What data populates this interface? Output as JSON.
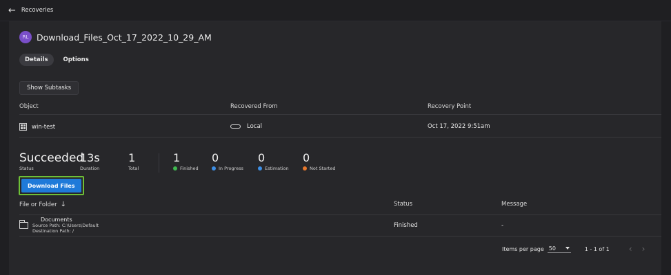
{
  "topbar": {
    "back_glyph": "←",
    "breadcrumb": "Recoveries"
  },
  "header": {
    "avatar_text": "RL",
    "title": "Download_Files_Oct_17_2022_10_29_AM"
  },
  "tabs": [
    {
      "label": "Details",
      "active": true
    },
    {
      "label": "Options",
      "active": false
    }
  ],
  "show_subtasks_label": "Show Subtasks",
  "objects_table": {
    "headers": {
      "object": "Object",
      "recovered_from": "Recovered From",
      "recovery_point": "Recovery Point"
    },
    "row": {
      "object": "win-test",
      "recovered_from": "Local",
      "recovery_point": "Oct 17, 2022 9:51am",
      "object_icon": "windows-icon",
      "source_icon": "cloud-icon"
    }
  },
  "stats": {
    "status_value": "Succeeded",
    "status_label": "Status",
    "duration_value": "13s",
    "duration_label": "Duration",
    "total_value": "1",
    "total_label": "Total",
    "finished_value": "1",
    "finished_label": "Finished",
    "in_progress_value": "0",
    "in_progress_label": "In Progress",
    "estimation_value": "0",
    "estimation_label": "Estimation",
    "not_started_value": "0",
    "not_started_label": "Not Started"
  },
  "colors": {
    "finished": "#3fb950",
    "in_progress": "#3d8fe6",
    "estimation": "#3d8fe6",
    "not_started": "#e6782d",
    "accent_button": "#1f7ad9",
    "highlight": "#6ec037"
  },
  "download_button_label": "Download Files",
  "files_table": {
    "headers": {
      "file_or_folder": "File or Folder",
      "sort_glyph": "↓",
      "status": "Status",
      "message": "Message"
    },
    "rows": [
      {
        "name": "Documents",
        "source_path": "Source Path: C:\\Users\\Default",
        "destination_path": "Destination Path: /",
        "status": "Finished",
        "message": "-"
      }
    ]
  },
  "pagination": {
    "items_per_page_label": "Items per page",
    "items_per_page_value": "50",
    "range": "1 - 1 of 1",
    "prev_glyph": "‹",
    "next_glyph": "›"
  }
}
